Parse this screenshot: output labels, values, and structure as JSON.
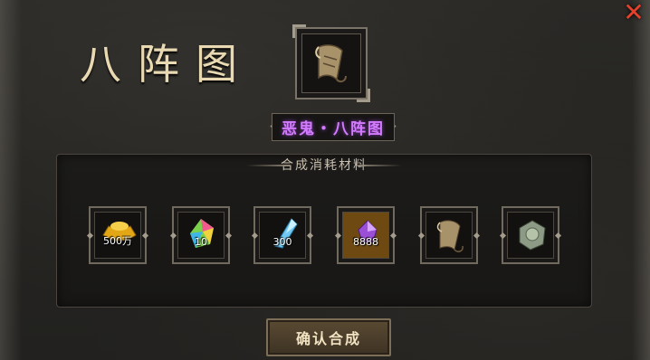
{
  "title": "八阵图",
  "item_name": "恶鬼・八阵图",
  "item_name_color": "#d37bff",
  "close_label": "✕",
  "materials_header": "合成消耗材料",
  "materials": [
    {
      "icon": "gold-ingot-icon",
      "count": "500万"
    },
    {
      "icon": "rainbow-gem-icon",
      "count": "10"
    },
    {
      "icon": "blue-crystal-icon",
      "count": "300"
    },
    {
      "icon": "purple-gem-icon",
      "count": "8888"
    },
    {
      "icon": "scroll-icon",
      "count": ""
    },
    {
      "icon": "jade-stone-icon",
      "count": ""
    }
  ],
  "top_item_icon": "scroll-icon",
  "confirm_label": "确认合成"
}
